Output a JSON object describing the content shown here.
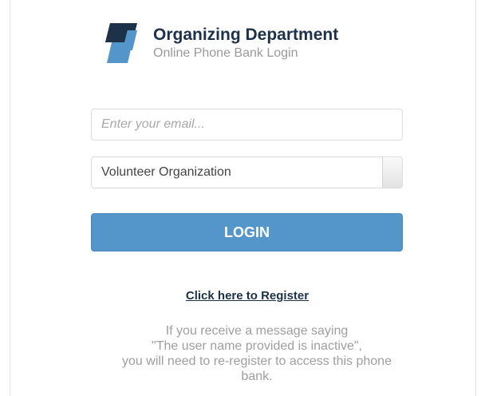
{
  "header": {
    "title": "Organizing Department",
    "subtitle": "Online Phone Bank Login",
    "logo_icon": "stacked-parallelogram-logo-icon",
    "colors": {
      "logo_dark": "#1d3148",
      "logo_light": "#5596ca",
      "title": "#1d3148",
      "subtitle": "#9a9a9a"
    }
  },
  "login_form": {
    "email_placeholder": "Enter your email...",
    "email_value": "",
    "organization_select_value": "Volunteer Organization",
    "login_label": "LOGIN",
    "colors": {
      "button_bg": "#5596ca",
      "button_text": "#ffffff"
    }
  },
  "register": {
    "link_text": "Click here to Register"
  },
  "notice": {
    "lines": [
      "If you receive a message saying",
      "\"The user name provided is inactive\",",
      "you will need to re-register to access this phone",
      "bank."
    ]
  }
}
